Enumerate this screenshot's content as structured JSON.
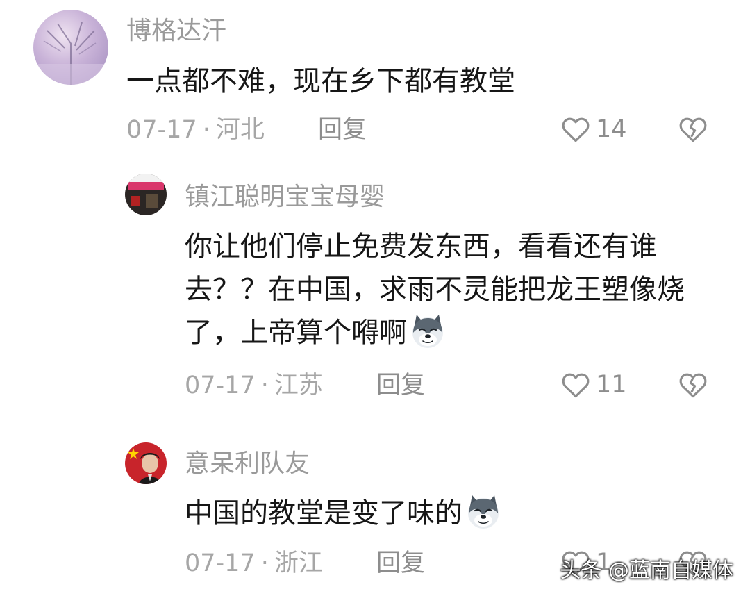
{
  "comments": [
    {
      "username": "博格达汗",
      "text": "一点都不难，现在乡下都有教堂",
      "date": "07-17",
      "location": "河北",
      "reply_label": "回复",
      "likes": "14"
    },
    {
      "username": "镇江聪明宝宝母婴",
      "text": "你让他们停止免费发东西，看看还有谁去？？在中国，求雨不灵能把龙王塑像烧了，上帝算个嘚啊",
      "date": "07-17",
      "location": "江苏",
      "reply_label": "回复",
      "likes": "11"
    },
    {
      "username": "意呆利队友",
      "text": "中国的教堂是变了味的",
      "date": "07-17",
      "location": "浙江",
      "reply_label": "回复",
      "likes": "1"
    }
  ],
  "meta_separator": "·",
  "watermark": "头条 @蓝南自媒体",
  "icons": {
    "like": "heart-outline-icon",
    "dislike": "broken-heart-icon",
    "emoji": "husky-dog-emoji"
  },
  "colors": {
    "username": "#9a9a9a",
    "body_text": "#161616",
    "meta": "#a6a6a6"
  }
}
